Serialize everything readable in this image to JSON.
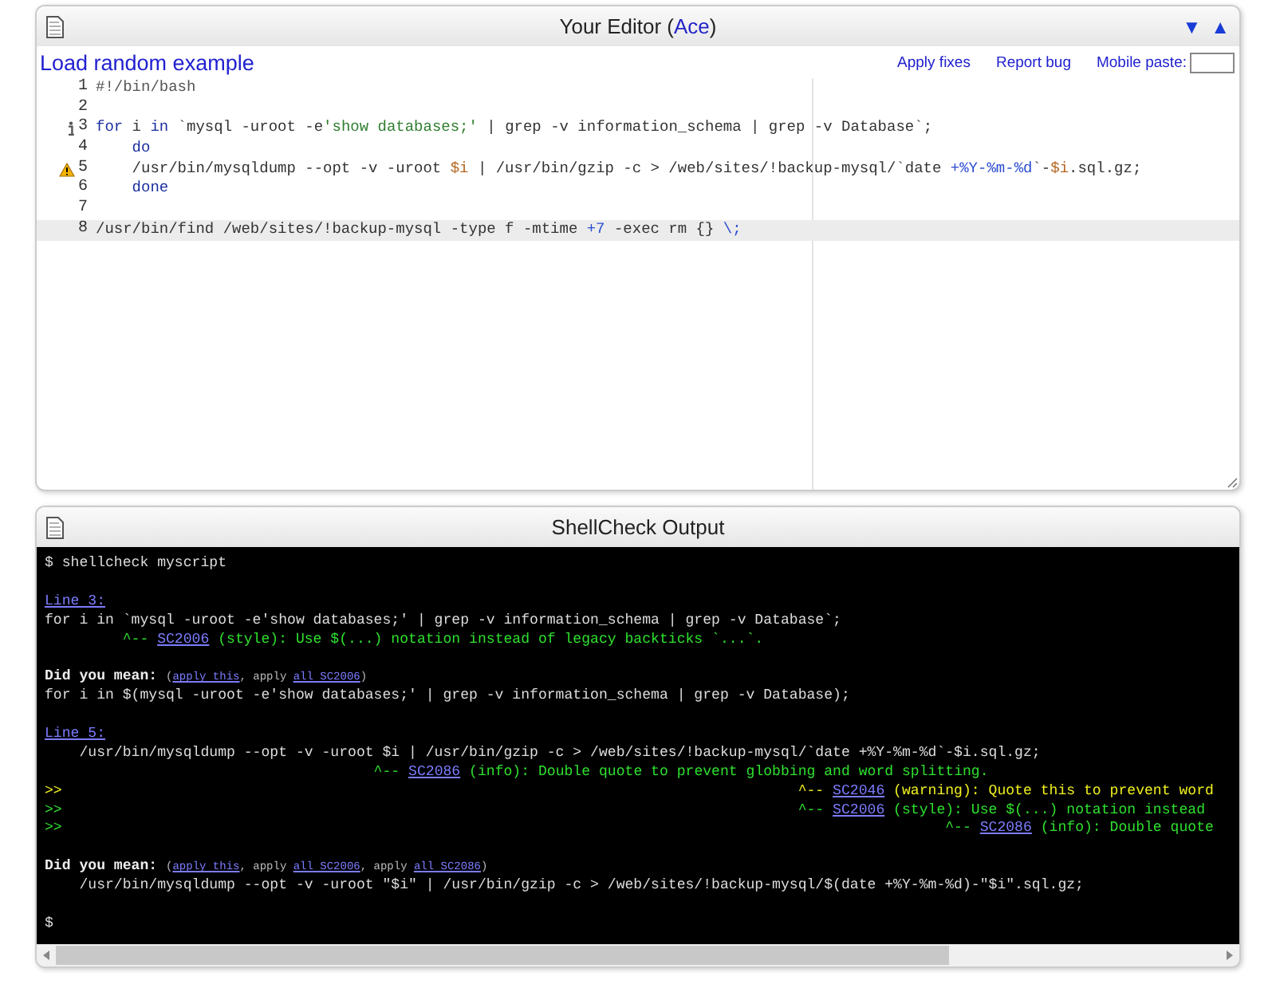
{
  "editor": {
    "title": "Your Editor (",
    "title_link": "Ace",
    "title_end": ")",
    "collapse": "▼",
    "expand": "▲",
    "load_link": "Load random example",
    "actions": [
      "Apply fixes",
      "Report bug"
    ],
    "paste_label": "Mobile paste:",
    "lines": [
      {
        "number": "1",
        "kind": "plain",
        "active": false,
        "segments": [
          {
            "text": "#!/bin/bash",
            "kind": "comment"
          }
        ]
      },
      {
        "number": "2",
        "kind": "plain",
        "active": false
      },
      {
        "number": "3",
        "kind": "info",
        "active": false,
        "segments": [
          {
            "text": "for",
            "kind": "keyword"
          },
          {
            "text": " i ",
            "kind": "plain"
          },
          {
            "text": "in",
            "kind": "keyword"
          },
          {
            "text": " `mysql -uroot -e",
            "kind": "plain"
          },
          {
            "text": "'show databases;'",
            "kind": "string"
          },
          {
            "text": " | grep -v information_schema | grep -v Database`;",
            "kind": "plain"
          }
        ]
      },
      {
        "number": "4",
        "kind": "plain",
        "active": false,
        "segments": [
          {
            "text": "    do",
            "kind": "keyword"
          }
        ]
      },
      {
        "number": "5",
        "kind": "warning",
        "active": false,
        "segments": [
          {
            "text": "    /usr/bin/mysqldump --opt -v -uroot ",
            "kind": "plain"
          },
          {
            "text": "$i",
            "kind": "variable"
          },
          {
            "text": " | /usr/bin/gzip -c > /web/sites/!backup-mysql/`date ",
            "kind": "plain"
          },
          {
            "text": "+%Y-%m-%d",
            "kind": "number"
          },
          {
            "text": "`-",
            "kind": "plain"
          },
          {
            "text": "$i",
            "kind": "variable"
          },
          {
            "text": ".sql.gz;",
            "kind": "plain"
          }
        ]
      },
      {
        "number": "6",
        "kind": "plain",
        "active": false,
        "segments": [
          {
            "text": "    done",
            "kind": "keyword"
          }
        ]
      },
      {
        "number": "7",
        "kind": "plain",
        "active": false
      },
      {
        "number": "8",
        "kind": "plain",
        "active": true,
        "segments": [
          {
            "text": "/usr/bin/find /web/sites/!backup-mysql -type f -mtime ",
            "kind": "plain"
          },
          {
            "text": "+7",
            "kind": "number"
          },
          {
            "text": " -exec rm {} ",
            "kind": "plain"
          },
          {
            "text": "\\;",
            "kind": "number"
          }
        ]
      }
    ]
  },
  "output": {
    "title": "ShellCheck Output",
    "lines": [
      {
        "kind": "text",
        "segments": [
          {
            "text": "$ shellcheck myscript",
            "kind": "plain"
          }
        ]
      },
      {
        "kind": "blank"
      },
      {
        "kind": "text",
        "segments": [
          {
            "text": "Line 3:",
            "kind": "link"
          }
        ]
      },
      {
        "kind": "text",
        "segments": [
          {
            "text": "for i in `mysql -uroot -e'show databases;' | grep -v information_schema | grep -v Database`;",
            "kind": "plain"
          }
        ]
      },
      {
        "kind": "text",
        "segments": [
          {
            "text": "         ^-- ",
            "kind": "style"
          },
          {
            "text": "SC2006",
            "kind": "link"
          },
          {
            "text": " (style): Use $(...) notation instead of legacy backticks `...`.",
            "kind": "style"
          }
        ]
      },
      {
        "kind": "blank"
      },
      {
        "kind": "text",
        "segments": [
          {
            "text": "Did you mean: ",
            "kind": "bold"
          },
          {
            "text": "(",
            "kind": "small"
          },
          {
            "text": "apply this",
            "kind": "small-link"
          },
          {
            "text": ", apply ",
            "kind": "small"
          },
          {
            "text": "all SC2006",
            "kind": "small-link"
          },
          {
            "text": ")",
            "kind": "small"
          }
        ]
      },
      {
        "kind": "text",
        "segments": [
          {
            "text": "for i in $(mysql -uroot -e'show databases;' | grep -v information_schema | grep -v Database);",
            "kind": "plain"
          }
        ]
      },
      {
        "kind": "blank"
      },
      {
        "kind": "text",
        "segments": [
          {
            "text": "Line 5:",
            "kind": "link"
          }
        ]
      },
      {
        "kind": "text",
        "segments": [
          {
            "text": "    /usr/bin/mysqldump --opt -v -uroot $i | /usr/bin/gzip -c > /web/sites/!backup-mysql/`date +%Y-%m-%d`-$i.sql.gz;",
            "kind": "plain"
          }
        ]
      },
      {
        "kind": "text",
        "segments": [
          {
            "text": "                                      ^-- ",
            "kind": "info"
          },
          {
            "text": "SC2086",
            "kind": "link"
          },
          {
            "text": " (info): Double quote to prevent globbing and word splitting.",
            "kind": "info"
          }
        ]
      },
      {
        "kind": "text",
        "segments": [
          {
            "text": ">>",
            "kind": "warning"
          },
          {
            "text": "                                                                                     ^-- ",
            "kind": "warning"
          },
          {
            "text": "SC2046",
            "kind": "link"
          },
          {
            "text": " (warning): Quote this to prevent word",
            "kind": "warning"
          }
        ]
      },
      {
        "kind": "text",
        "segments": [
          {
            "text": ">>",
            "kind": "style"
          },
          {
            "text": "                                                                                     ^-- ",
            "kind": "style"
          },
          {
            "text": "SC2006",
            "kind": "link"
          },
          {
            "text": " (style): Use $(...) notation instead",
            "kind": "style"
          }
        ]
      },
      {
        "kind": "text",
        "segments": [
          {
            "text": ">>",
            "kind": "info"
          },
          {
            "text": "                                                                                                      ^-- ",
            "kind": "info"
          },
          {
            "text": "SC2086",
            "kind": "link"
          },
          {
            "text": " (info): Double quote",
            "kind": "info"
          }
        ]
      },
      {
        "kind": "blank"
      },
      {
        "kind": "text",
        "segments": [
          {
            "text": "Did you mean: ",
            "kind": "bold"
          },
          {
            "text": "(",
            "kind": "small"
          },
          {
            "text": "apply this",
            "kind": "small-link"
          },
          {
            "text": ", apply ",
            "kind": "small"
          },
          {
            "text": "all SC2006",
            "kind": "small-link"
          },
          {
            "text": ", apply ",
            "kind": "small"
          },
          {
            "text": "all SC2086",
            "kind": "small-link"
          },
          {
            "text": ")",
            "kind": "small"
          }
        ]
      },
      {
        "kind": "text",
        "segments": [
          {
            "text": "    /usr/bin/mysqldump --opt -v -uroot \"$i\" | /usr/bin/gzip -c > /web/sites/!backup-mysql/$(date +%Y-%m-%d)-\"$i\".sql.gz;",
            "kind": "plain"
          }
        ]
      },
      {
        "kind": "blank"
      },
      {
        "kind": "text",
        "segments": [
          {
            "text": "$",
            "kind": "plain"
          }
        ]
      }
    ]
  }
}
